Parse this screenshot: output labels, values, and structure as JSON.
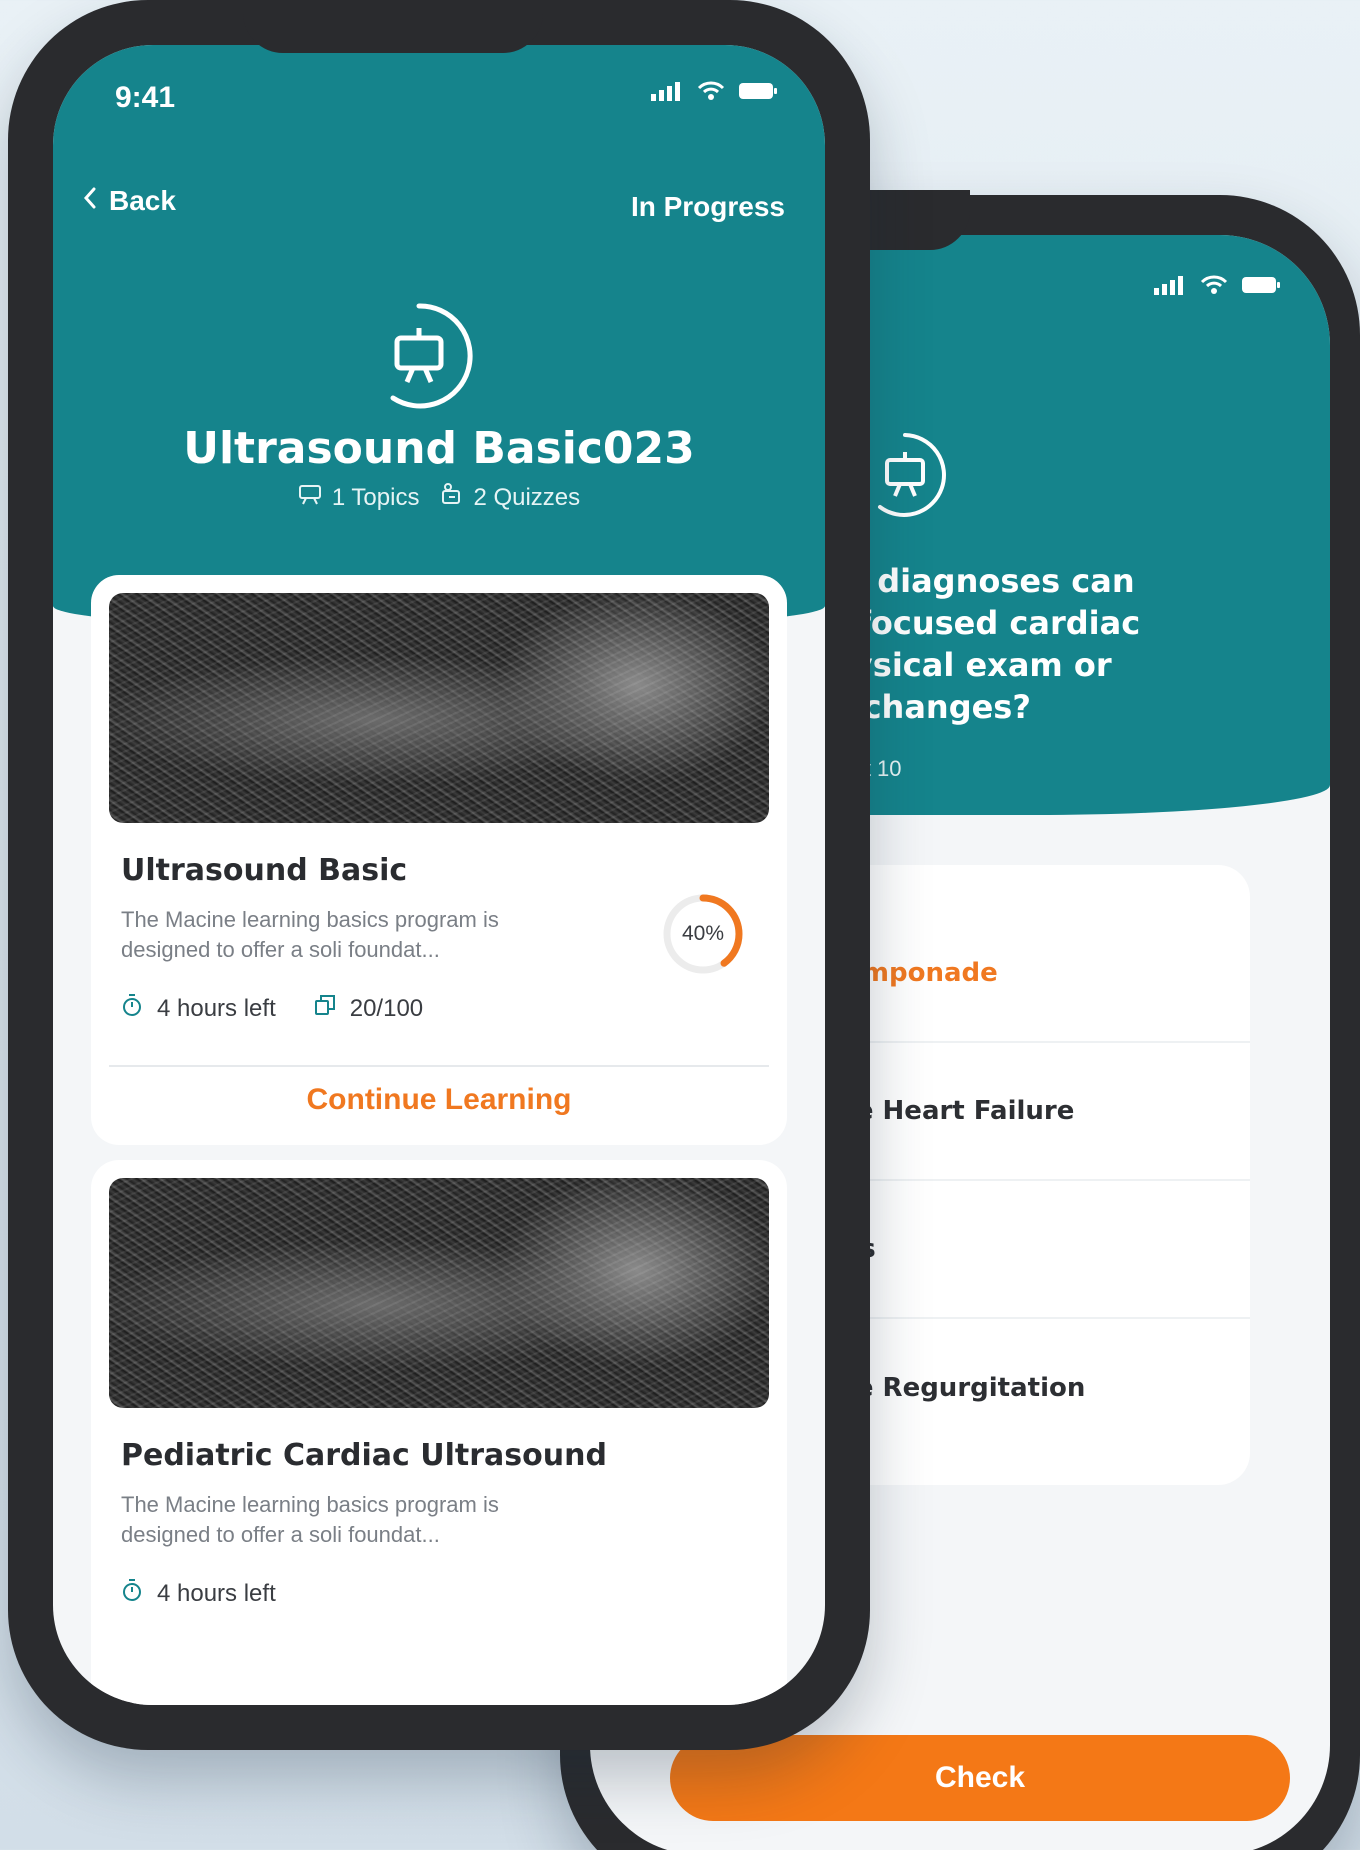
{
  "back_screen": {
    "question": "following diagnoses can early by focused cardiac efore physical exam or dynamic changes?",
    "question_lines": [
      "following diagnoses can",
      "early by focused cardiac",
      "efore physical exam or",
      "dynamic changes?"
    ],
    "progress_text": "6 out 10",
    "answers": [
      {
        "label": "Tamponade",
        "selected": true
      },
      {
        "label": "ive Heart Failure",
        "selected": false
      },
      {
        "label": "itis",
        "selected": false
      },
      {
        "label": "lve Regurgitation",
        "selected": false
      }
    ],
    "check_label": "Check"
  },
  "front_screen": {
    "status": {
      "time": "9:41"
    },
    "nav": {
      "back_label": "Back",
      "status_label": "In Progress"
    },
    "course": {
      "title": "Ultrasound Basic023",
      "topics": "1 Topics",
      "quizzes": "2 Quizzes"
    },
    "cards": [
      {
        "title": "Ultrasound Basic",
        "desc_lines": [
          "The Macine learning basics program is",
          "designed to offer a soli foundat..."
        ],
        "time_left": "4 hours left",
        "lessons": "20/100",
        "progress_percent": 40,
        "progress_label": "40%",
        "cta": "Continue Learning"
      },
      {
        "title": "Pediatric Cardiac Ultrasound",
        "desc_lines": [
          "The Macine learning basics program is",
          "designed to offer a soli foundat..."
        ],
        "time_left": "4 hours left"
      }
    ]
  },
  "colors": {
    "teal": "#15848c",
    "orange": "#f07820",
    "device": "#2a2b2e"
  }
}
